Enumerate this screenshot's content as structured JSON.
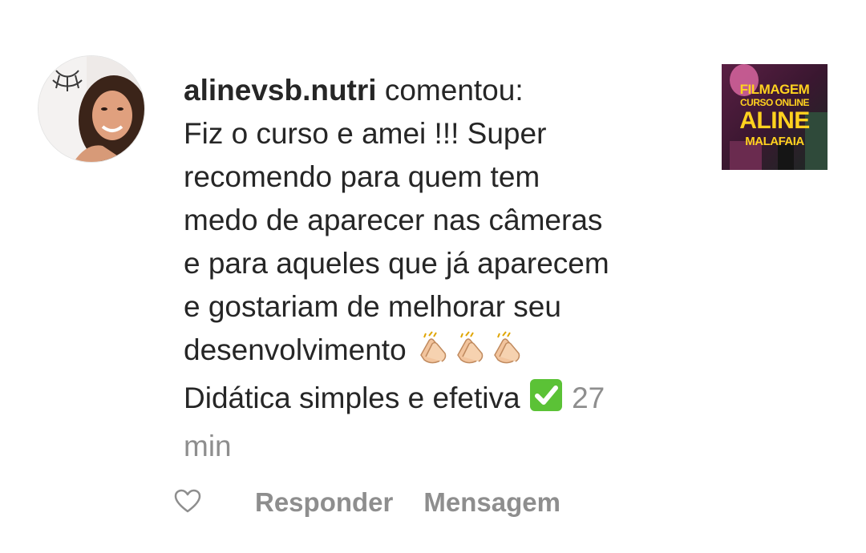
{
  "comment": {
    "username": "alinevsb.nutri",
    "verb": "comentou:",
    "lines": [
      "Fiz o curso e amei !!! Super",
      "recomendo para quem tem",
      "medo de aparecer nas câmeras",
      "e para aqueles que já aparecem",
      "e gostariam de melhorar seu",
      "desenvolvimento",
      "Didática simples e efetiva"
    ],
    "time_a": "27",
    "time_b": "min"
  },
  "thumbnail": {
    "line1": "FILMAGEM",
    "line2": "CURSO ONLINE",
    "line3": "ALINE",
    "line4": "MALAFAIA"
  },
  "actions": {
    "reply_label": "Responder",
    "message_label": "Mensagem"
  },
  "icons": {
    "avatar": "profile-photo",
    "like": "heart-outline-icon",
    "clap": "clapping-hands-emoji",
    "check": "check-mark-button-emoji"
  },
  "colors": {
    "text": "#262626",
    "secondary": "#8e8e8e",
    "check_emoji": "#5bc236",
    "thumbnail_text": "#ffd21f"
  }
}
